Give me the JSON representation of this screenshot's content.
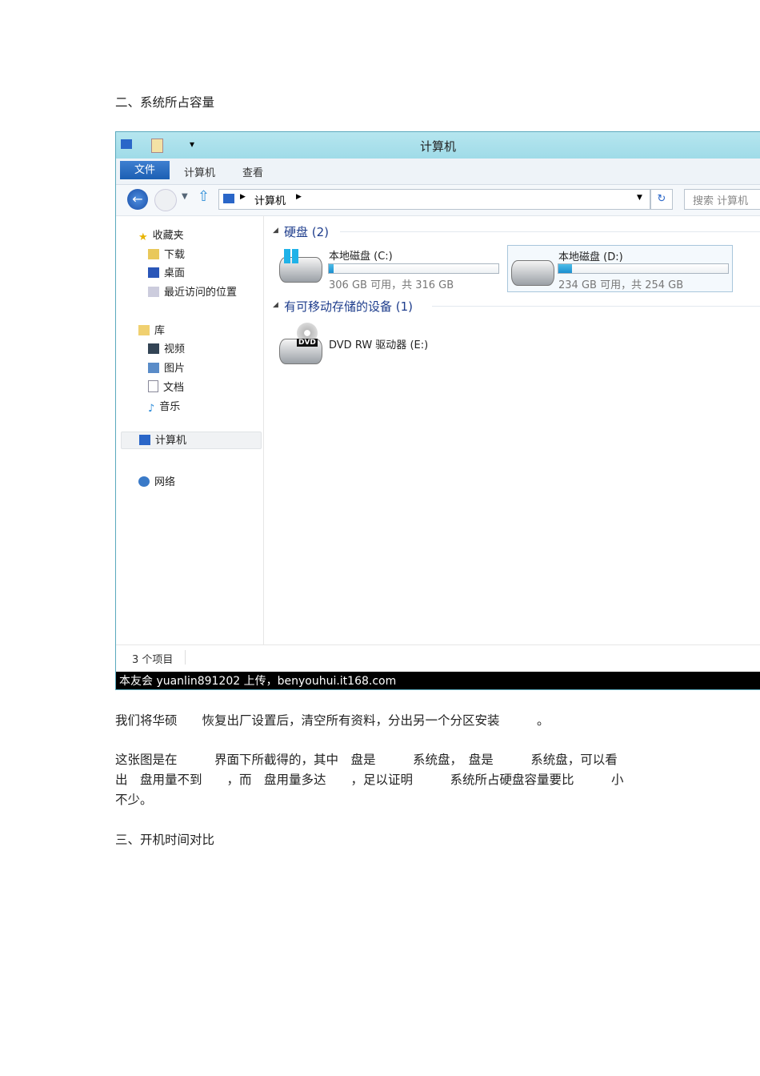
{
  "doc": {
    "heading2": "二、系统所占容量",
    "p1": "我们将华硕　　恢复出厂设置后，清空所有资料，分出另一个分区安装　　　。",
    "p2_l1": "这张图是在　　　界面下所截得的，其中　盘是　　　系统盘，　盘是　　　系统盘，可以看",
    "p2_l2": "出　盘用量不到　　，而　盘用量多达　　，足以证明　　　系统所占硬盘容量要比　　　小",
    "p2_l3": "不少。",
    "heading3": "三、开机时间对比"
  },
  "explorer": {
    "title": "计算机",
    "tabs": [
      "文件",
      "计算机",
      "查看"
    ],
    "address": "计算机",
    "search_placeholder": "搜索 计算机",
    "sidebar": {
      "favorites": "收藏夹",
      "downloads": "下载",
      "desktop": "桌面",
      "recent": "最近访问的位置",
      "libraries": "库",
      "videos": "视频",
      "pictures": "图片",
      "documents": "文档",
      "music": "音乐",
      "computer": "计算机",
      "network": "网络"
    },
    "groups": {
      "hdd": "硬盘 (2)",
      "removable": "有可移动存储的设备 (1)"
    },
    "drives": [
      {
        "name": "本地磁盘 (C:)",
        "caption": "306 GB 可用，共 316 GB",
        "used_fraction": 0.03
      },
      {
        "name": "本地磁盘 (D:)",
        "caption": "234 GB 可用，共 254 GB",
        "used_fraction": 0.08
      }
    ],
    "dvd": {
      "name": "DVD RW 驱动器 (E:)",
      "badge": "DVD"
    },
    "status": "3 个项目",
    "watermark": "本友会 yuanlin891202 上传，benyouhui.it168.com"
  },
  "colors": {
    "accent": "#1b5fb3",
    "group": "#1e3d8c"
  }
}
